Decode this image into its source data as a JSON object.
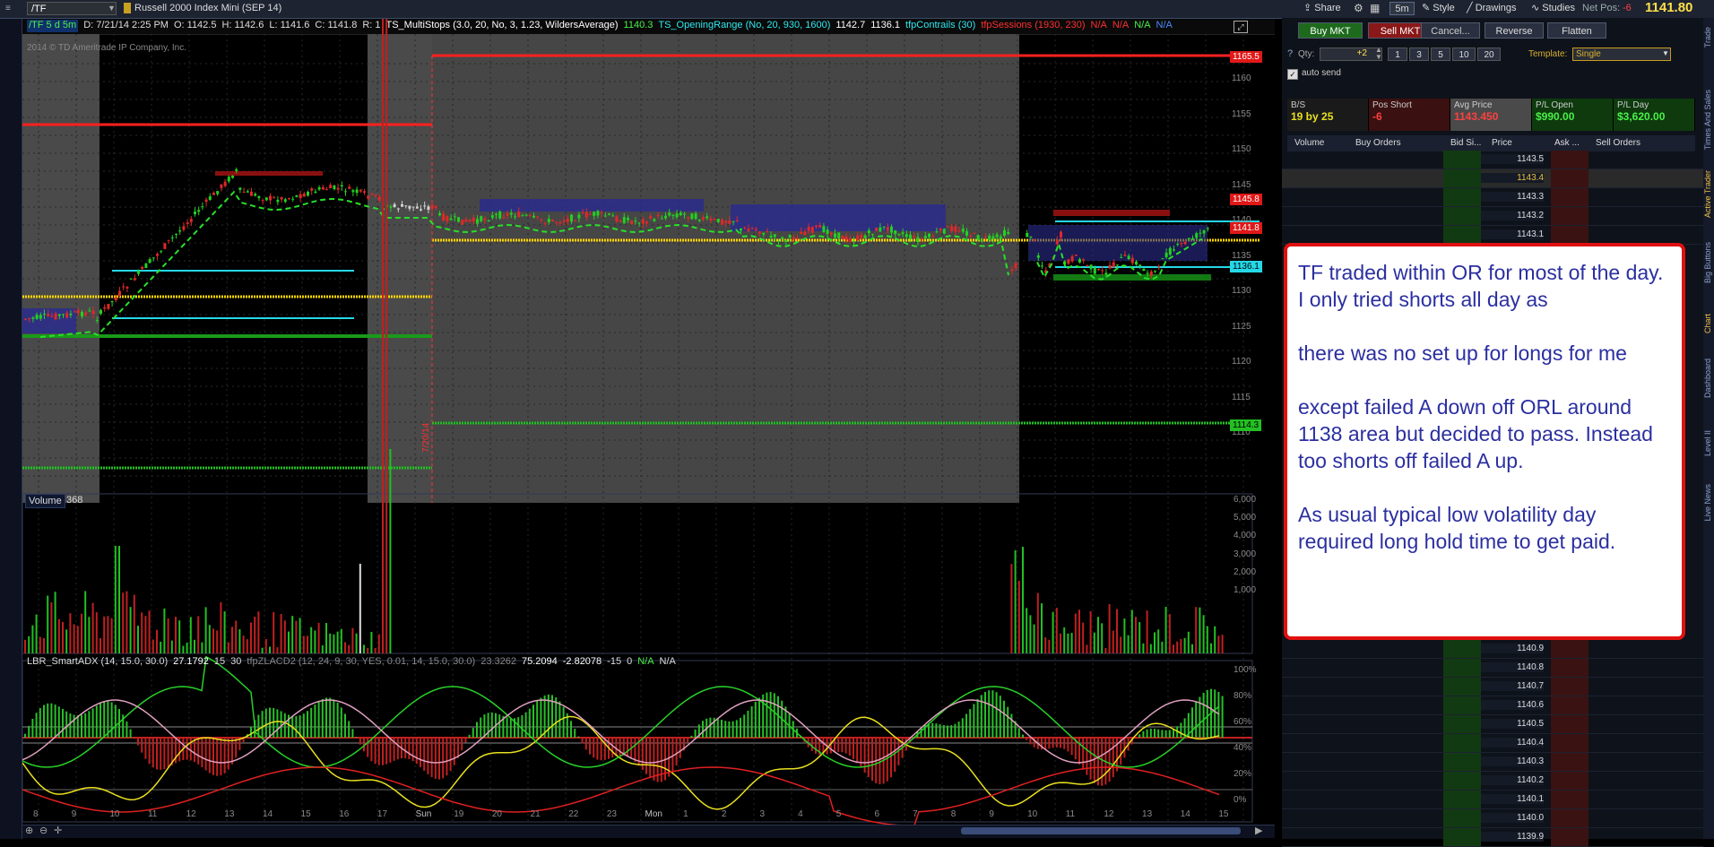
{
  "topbar": {
    "symbol": "/TF",
    "description": "Russell 2000 Index Mini (SEP 14)",
    "share": "Share",
    "timeframe": "5m",
    "style": "Style",
    "drawings": "Drawings",
    "studies": "Studies",
    "net_pos_label": "Net Pos:",
    "net_pos_value": "-6",
    "last_price": "1141.80"
  },
  "studies": [
    {
      "text": "/TF 5 d 5m",
      "color": "#4af04a"
    },
    {
      "text": "D: 7/21/14 2:25 PM",
      "color": "#dddddd"
    },
    {
      "text": "O: 1142.5",
      "color": "#dddddd"
    },
    {
      "text": "H: 1142.6",
      "color": "#dddddd"
    },
    {
      "text": "L: 1141.6",
      "color": "#dddddd"
    },
    {
      "text": "C: 1141.8",
      "color": "#dddddd"
    },
    {
      "text": "R: 1",
      "color": "#dddddd"
    },
    {
      "text": "TS_MultiStops (3.0, 20, No, 3, 1.23, WildersAverage)",
      "color": "#ffffff"
    },
    {
      "text": "1140.3",
      "color": "#4af04a"
    },
    {
      "text": "TS_OpeningRange (No, 20, 930, 1600)",
      "color": "#2ee8f0"
    },
    {
      "text": "1142.7",
      "color": "#ffffff"
    },
    {
      "text": "1136.1",
      "color": "#ffffff"
    },
    {
      "text": "tfpContrails (30)",
      "color": "#2ee8f0"
    },
    {
      "text": "tfpSessions (1930, 230)",
      "color": "#ff3030"
    },
    {
      "text": "N/A",
      "color": "#ff3030"
    },
    {
      "text": "N/A",
      "color": "#ff3030"
    },
    {
      "text": "N/A",
      "color": "#4af04a"
    },
    {
      "text": "N/A",
      "color": "#4a8cff"
    }
  ],
  "chart": {
    "copyright": "2014 © TD Ameritrade IP Company, Inc.",
    "price_axis": [
      "1160",
      "1155",
      "1150",
      "1145",
      "1140",
      "1135",
      "1130",
      "1125",
      "1120",
      "1115",
      "1110"
    ],
    "price_tags": [
      {
        "text": "1165.5",
        "bg": "#e01818"
      },
      {
        "text": "1145.8",
        "bg": "#e01818"
      },
      {
        "text": "1141.8",
        "bg": "#e01818"
      },
      {
        "text": "1136.1",
        "bg": "#24d8e8"
      },
      {
        "text": "1114.3",
        "bg": "#22c022"
      }
    ],
    "date_marker": "7/20/14",
    "volume_label": "Volume",
    "volume_value": "368",
    "volume_axis": [
      "6,000",
      "5,000",
      "4,000",
      "3,000",
      "2,000",
      "1,000"
    ],
    "adx_studies": [
      {
        "text": "LBR_SmartADX (14, 15.0, 30.0)",
        "color": "#dddddd"
      },
      {
        "text": "27.1792",
        "color": "#ffffff"
      },
      {
        "text": "15",
        "color": "#dddddd"
      },
      {
        "text": "30",
        "color": "#dddddd"
      },
      {
        "text": "tfpZLACD2 (12, 24, 9, 30, YES, 0.01, 14, 15.0, 30.0)",
        "color": "#888888"
      },
      {
        "text": "23.3262",
        "color": "#888888"
      },
      {
        "text": "75.2094",
        "color": "#ffffff"
      },
      {
        "text": "-2.82078",
        "color": "#ffffff"
      },
      {
        "text": "-15",
        "color": "#dddddd"
      },
      {
        "text": "0",
        "color": "#dddddd"
      },
      {
        "text": "N/A",
        "color": "#4af04a"
      },
      {
        "text": "N/A",
        "color": "#dddddd"
      }
    ],
    "adx_axis": [
      "100%",
      "80%",
      "60%",
      "40%",
      "20%",
      "0%"
    ],
    "time_axis": [
      "8",
      "9",
      "10",
      "11",
      "12",
      "13",
      "14",
      "15",
      "16",
      "17",
      "Sun",
      "19",
      "20",
      "21",
      "22",
      "23",
      "Mon",
      "1",
      "2",
      "3",
      "4",
      "5",
      "6",
      "7",
      "8",
      "9",
      "10",
      "11",
      "12",
      "13",
      "14",
      "15"
    ]
  },
  "trade": {
    "buy_mkt": "Buy MKT",
    "sell_mkt": "Sell MKT",
    "cancel": "Cancel...",
    "reverse": "Reverse",
    "flatten": "Flatten",
    "qty_label": "Qty:",
    "qty_value": "+2",
    "qty_presets": [
      "1",
      "3",
      "5",
      "10",
      "20"
    ],
    "template_label": "Template:",
    "template_value": "Single",
    "auto_send": "auto send",
    "stats": [
      {
        "label": "B/S",
        "value": "19 by 25"
      },
      {
        "label": "Pos Short",
        "value": "-6"
      },
      {
        "label": "Avg Price",
        "value": "1143.450"
      },
      {
        "label": "P/L Open",
        "value": "$990.00"
      },
      {
        "label": "P/L Day",
        "value": "$3,620.00"
      }
    ],
    "ladder_headers": [
      "Volume",
      "Buy Orders",
      "Bid Si...",
      "Price",
      "Ask ...",
      "Sell Orders"
    ],
    "ladder_top": [
      "1143.5",
      "1143.4",
      "1143.3",
      "1143.2",
      "1143.1"
    ],
    "ladder_bottom": [
      "1140.9",
      "1140.8",
      "1140.7",
      "1140.6",
      "1140.5",
      "1140.4",
      "1140.3",
      "1140.2",
      "1140.1",
      "1140.0",
      "1139.9"
    ]
  },
  "side_tabs": [
    "Trade",
    "Times And Sales",
    "Active Trader",
    "Big Buttons",
    "Chart",
    "Dashboard",
    "Level II",
    "Live News"
  ],
  "note": {
    "line1": "TF traded within OR for most of the day.  I only tried shorts all day as",
    "line2": "there was no set up for longs for me",
    "line3": "except failed A down off ORL around 1138 area but decided to pass. Instead too shorts off failed A up.",
    "line4": "As usual typical low volatility day required long hold time to get paid."
  },
  "colors": {
    "accent_red": "#e01818",
    "accent_green": "#22c022",
    "accent_cyan": "#24d8e8",
    "accent_yellow": "#ffd400",
    "note_text": "#2b2fa0"
  }
}
